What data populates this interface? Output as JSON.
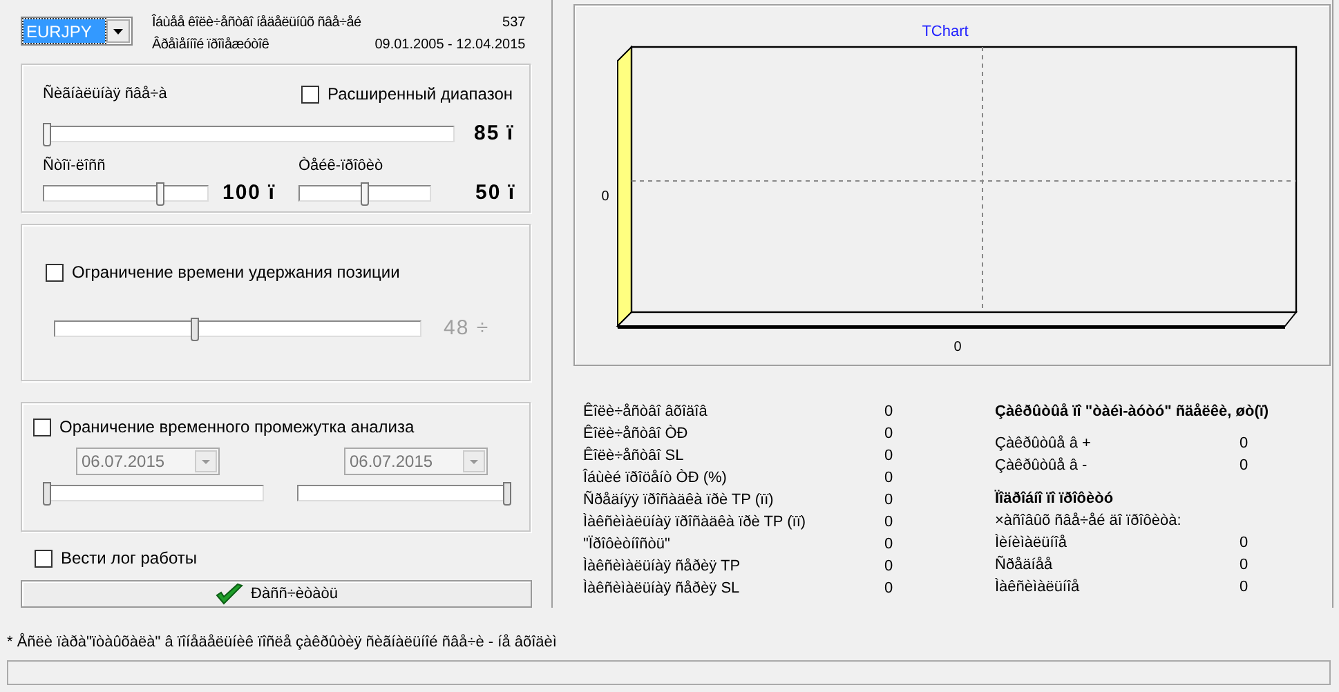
{
  "symbol_select": {
    "value": "EURJPY"
  },
  "info": [
    {
      "label": "Îáùåå êîëè÷åñòâî íåäåëüíûõ ñâå÷åé",
      "value": "537"
    },
    {
      "label": "Âðåìåííîé ïðîìåæóòîê",
      "value": "09.01.2005 - 12.04.2015"
    }
  ],
  "signal_group": {
    "label": "Ñèãíàëüíàÿ ñâå÷à",
    "extended_range": {
      "label": "Расширенный диапазон",
      "checked": false
    },
    "signal_slider": {
      "level": 0,
      "reading": "85 ï"
    },
    "stop_loss": {
      "label": "Ñòîï-ëîññ",
      "level": 0.72,
      "reading": "100 ï"
    },
    "take_profit": {
      "label": "Òåéê-ïðîôèò",
      "level": 0.5,
      "reading": "50 ï"
    }
  },
  "hold_group": {
    "checkbox": {
      "label": "Ограничение времени удержания позиции",
      "checked": false
    },
    "slider": {
      "level": 0.38,
      "reading": "48 ÷",
      "disabled": true
    }
  },
  "period_group": {
    "checkbox": {
      "label": "Ораничение временного промежутка анализа",
      "checked": false
    },
    "from": {
      "value": "06.07.2015",
      "level": 0,
      "disabled": true
    },
    "to": {
      "value": "06.07.2015",
      "level": 1,
      "disabled": true
    }
  },
  "log_checkbox": {
    "label": "Вести лог работы",
    "checked": false
  },
  "run_button": {
    "label": "Ðàññ÷èòàòü"
  },
  "chart": {
    "title": "TChart",
    "y_axis_label": "0",
    "x_axis_label": "0"
  },
  "stats": [
    {
      "label": "Êîëè÷åñòâî âõîäîâ",
      "value": "0"
    },
    {
      "label": "Êîëè÷åñòâî ÒÐ",
      "value": "0"
    },
    {
      "label": "Êîëè÷åñòâî SL",
      "value": "0"
    },
    {
      "label": "Îáùèé ïðîöåíò ÒÐ   (%)",
      "value": "0"
    },
    {
      "label": "Ñðåäíÿÿ ïðîñàäêà ïðè TP (ïï)",
      "value": "0"
    },
    {
      "label": "Ìàêñèìàëüíàÿ ïðîñàäêà ïðè TP (ïï)",
      "value": "0"
    },
    {
      "label": "\"Ïðîôèòíîñòü\"",
      "value": "0"
    },
    {
      "label": "Ìàêñèìàëüíàÿ ñåðèÿ TP",
      "value": "0"
    },
    {
      "label": "Ìàêñèìàëüíàÿ ñåðèÿ SL",
      "value": "0"
    }
  ],
  "timeout_section": {
    "title": "Çàêðûòûå ïî \"òàéì-àóòó\" ñäåëêè, øò(ï)",
    "rows": [
      {
        "label": "Çàêðûòûå â +",
        "value": "0"
      },
      {
        "label": "Çàêðûòûå â -",
        "value": "0"
      }
    ]
  },
  "profit_section": {
    "title": "Ïîäðîáíî ïî ïðîôèòó",
    "subtitle": "×àñîâûõ ñâå÷åé äî ïðîôèòà:",
    "rows": [
      {
        "label": "Ìèíèìàëüíîå",
        "value": "0"
      },
      {
        "label": "Ñðåäíåå",
        "value": "0"
      },
      {
        "label": "Ìàêñèìàëüíîå",
        "value": "0"
      }
    ]
  },
  "footnote": "* Åñëè ïàðà\"ïòàûõàëà\" â ïîíåäåëüíèê ïîñëå çàêðûòèÿ ñèãíàëüíîé ñâå÷è - íå âõîäèì"
}
